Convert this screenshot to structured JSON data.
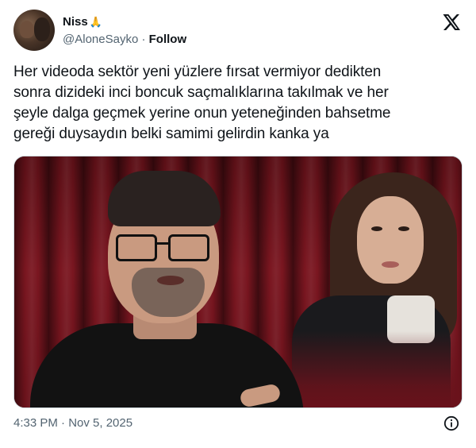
{
  "author": {
    "display_name": "Niss",
    "name_emoji": "🙏",
    "handle": "@AloneSayko",
    "separator": " · ",
    "follow_label": "Follow"
  },
  "platform_icon": "x-logo-icon",
  "tweet": {
    "text": "Her videoda sektör yeni yüzlere fırsat vermiyor dedikten\nsonra dizideki inci boncuk saçmalıklarına takılmak ve her\nşeyle dalga geçmek yerine onun yeteneğinden bahsetme\ngereği duysaydın belki samimi gelirdin kanka ya"
  },
  "footer": {
    "timestamp": "4:33 PM · Nov 5, 2025",
    "info_icon": "info-icon"
  },
  "colors": {
    "text_primary": "#0f1419",
    "text_secondary": "#536471",
    "border": "#cfd9de",
    "curtain_red": "#7a1620"
  }
}
